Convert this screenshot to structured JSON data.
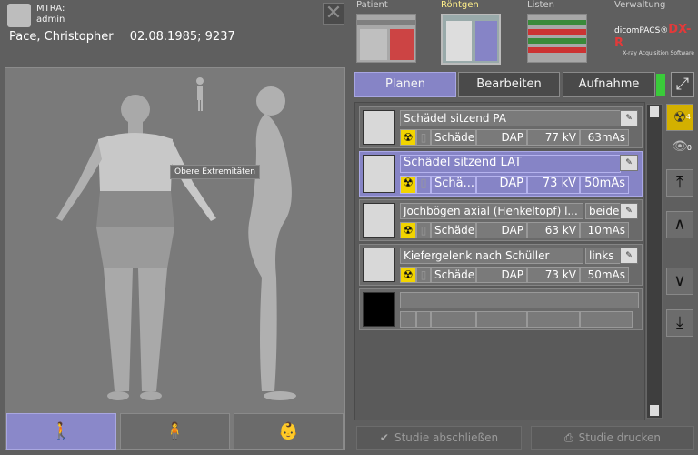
{
  "user": {
    "role": "MTRA:",
    "name": "admin"
  },
  "patient": {
    "name": "Pace, Christopher",
    "info": "02.08.1985; 9237"
  },
  "modules": [
    {
      "label": "Patient"
    },
    {
      "label": "Röntgen"
    },
    {
      "label": "Listen"
    },
    {
      "label": "Verwaltung"
    }
  ],
  "logo": {
    "text1": "dicomPACS®",
    "text2": "DX-R",
    "text3": "X-ray Acquisition Software"
  },
  "body_map": {
    "tooltip": "Obere Extremitäten"
  },
  "tabs": {
    "planen": "Planen",
    "bearbeiten": "Bearbeiten",
    "aufnahme": "Aufnahme"
  },
  "exams": [
    {
      "title": "Schädel sitzend PA",
      "side": "",
      "region": "Schädel",
      "dose": "DAP",
      "kv": "77 kV",
      "mas": "63mAs"
    },
    {
      "title": "Schädel sitzend LAT",
      "side": "",
      "region": "Schä...",
      "dose": "DAP",
      "kv": "73 kV",
      "mas": "50mAs"
    },
    {
      "title": "Jochbögen axial (Henkeltopf) l...",
      "side": "beide",
      "region": "Schädel",
      "dose": "DAP",
      "kv": "63 kV",
      "mas": "10mAs"
    },
    {
      "title": "Kiefergelenk nach Schüller",
      "side": "links",
      "region": "Schädel",
      "dose": "DAP",
      "kv": "73 kV",
      "mas": "50mAs"
    }
  ],
  "side_panel": {
    "rad_count": "4",
    "eye_count": "0"
  },
  "actions": {
    "close_study": "Studie abschließen",
    "print_study": "Studie drucken"
  },
  "colors": {
    "accent": "#8684c6",
    "status": "#3acb3a",
    "radiation": "#f2d400"
  }
}
